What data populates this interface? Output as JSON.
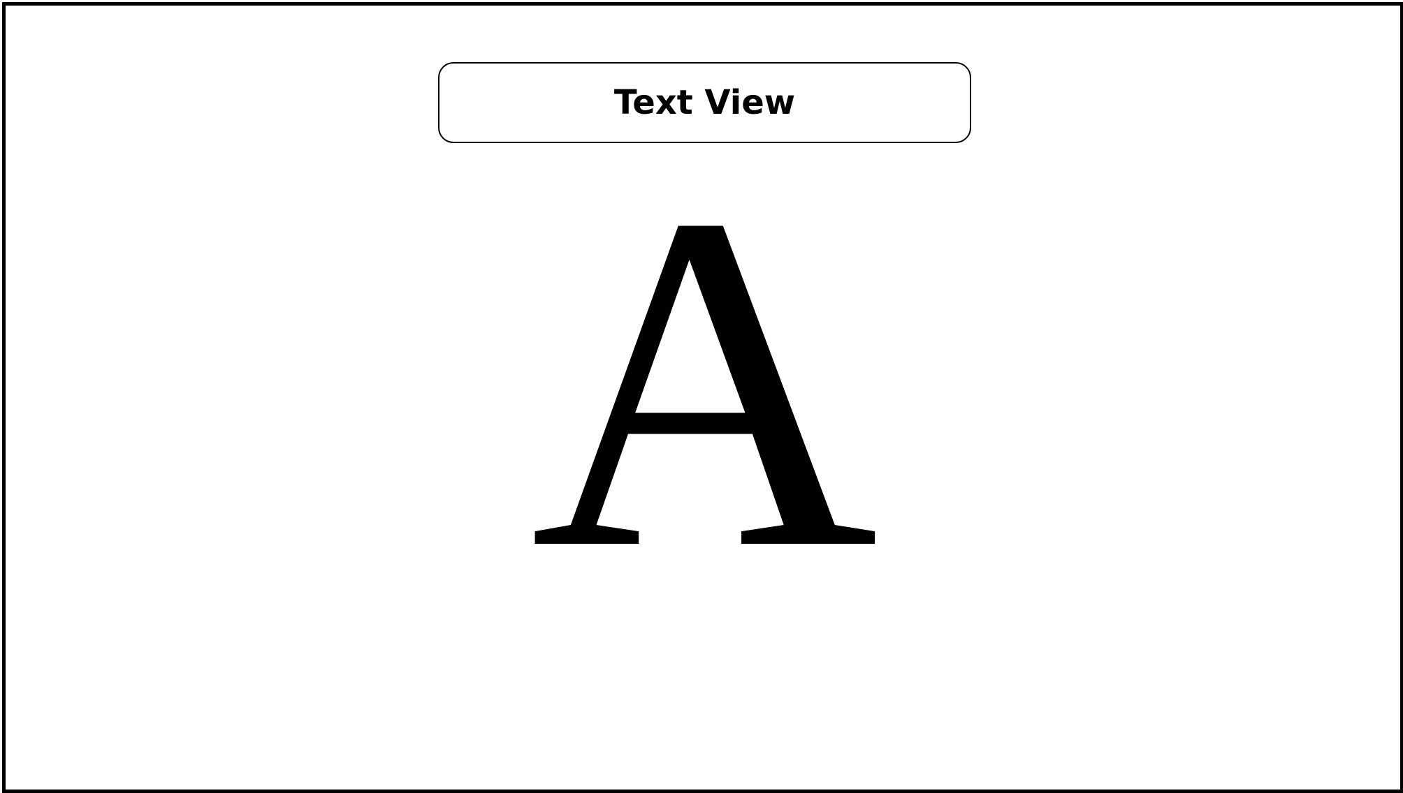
{
  "component": {
    "title": "Text View",
    "displayed_text": "A"
  },
  "colors": {
    "border": "#000000",
    "background": "#ffffff",
    "text": "#000000"
  }
}
